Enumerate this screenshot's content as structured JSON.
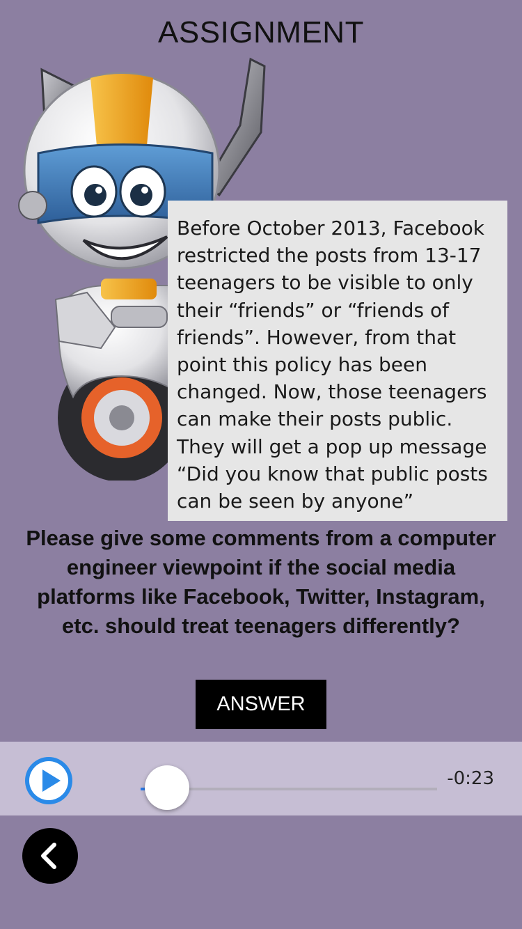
{
  "header": {
    "title": "ASSIGNMENT"
  },
  "mascot": {
    "icon": "robot-mascot-icon",
    "colors": {
      "body": "#e8e8ec",
      "helmet_stripe": "#f2a417",
      "visor": "#3c7bbf",
      "wheel": "#333333",
      "wheel_rim": "#e6622a"
    }
  },
  "content": {
    "paragraph": "Before October 2013, Facebook restricted the posts from 13-17 teenagers to be visible to only their “friends” or “friends of friends”. However, from that point this policy has been changed. Now, those teenagers can make their posts public. They will get a pop up message “Did you know that public posts can be seen by anyone”"
  },
  "question": {
    "text": "Please give some comments from a computer engineer viewpoint if the social media platforms like Facebook, Twitter, Instagram, etc. should treat teenagers differently?"
  },
  "actions": {
    "answer_label": "ANSWER"
  },
  "audio_player": {
    "play_icon": "play-icon",
    "remaining_time": "-0:23",
    "progress": 0.0,
    "accent_color": "#2a7ae8"
  },
  "navigation": {
    "back_icon": "chevron-left-icon"
  },
  "colors": {
    "background": "#8c7fa1",
    "player_bar": "#c6bed4",
    "text_box": "#e6e6e6"
  }
}
